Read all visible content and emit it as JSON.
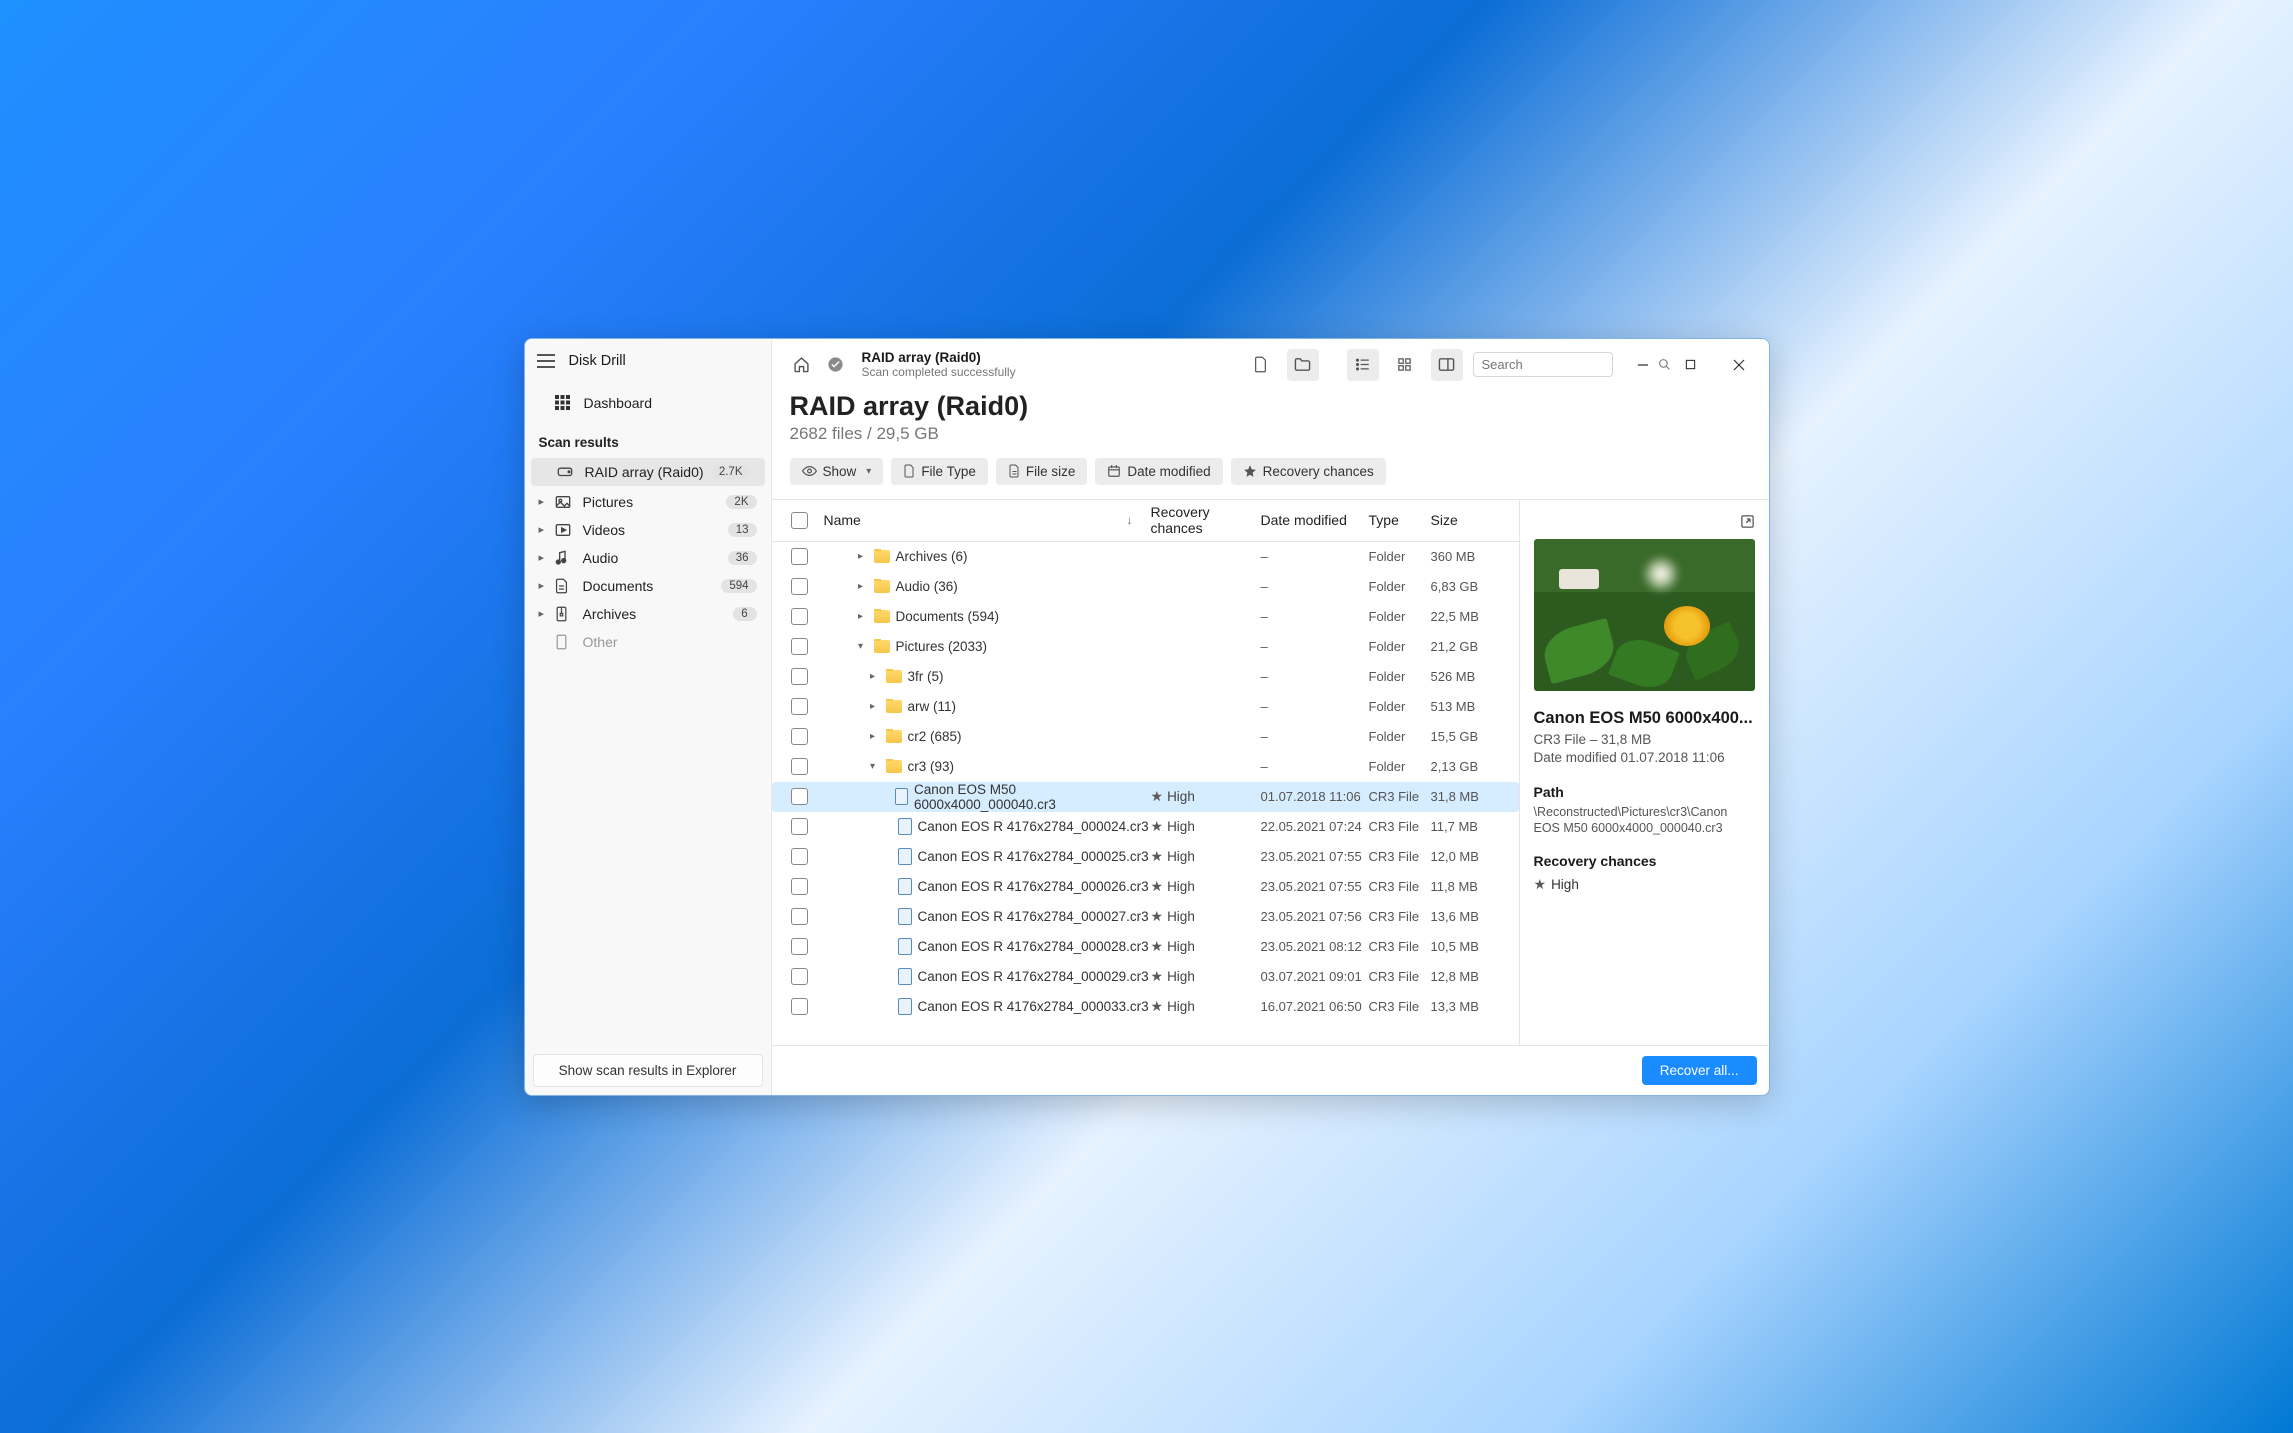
{
  "app_title": "Disk Drill",
  "dashboard_label": "Dashboard",
  "scan_results_label": "Scan results",
  "sidebar_items": [
    {
      "label": "RAID array (Raid0)",
      "count": "2.7K",
      "root": true,
      "icon": "drive"
    },
    {
      "label": "Pictures",
      "count": "2K",
      "icon": "image"
    },
    {
      "label": "Videos",
      "count": "13",
      "icon": "video"
    },
    {
      "label": "Audio",
      "count": "36",
      "icon": "audio"
    },
    {
      "label": "Documents",
      "count": "594",
      "icon": "doc"
    },
    {
      "label": "Archives",
      "count": "6",
      "icon": "archive"
    },
    {
      "label": "Other",
      "count": "",
      "icon": "other",
      "no_chevron": true
    }
  ],
  "explore_button": "Show scan results in Explorer",
  "crumb_title": "RAID array (Raid0)",
  "crumb_sub": "Scan completed successfully",
  "search_placeholder": "Search",
  "page_title": "RAID array (Raid0)",
  "page_sub": "2682 files / 29,5 GB",
  "filters": {
    "show": "Show",
    "file_type": "File Type",
    "file_size": "File size",
    "date_modified": "Date modified",
    "recovery_chances": "Recovery chances"
  },
  "columns": {
    "name": "Name",
    "recovery": "Recovery chances",
    "date": "Date modified",
    "type": "Type",
    "size": "Size"
  },
  "rows": [
    {
      "indent": 0,
      "chev": "r",
      "kind": "folder",
      "name": "Archives (6)",
      "rec": "",
      "date": "–",
      "type": "Folder",
      "size": "360 MB"
    },
    {
      "indent": 0,
      "chev": "r",
      "kind": "folder",
      "name": "Audio (36)",
      "rec": "",
      "date": "–",
      "type": "Folder",
      "size": "6,83 GB"
    },
    {
      "indent": 0,
      "chev": "r",
      "kind": "folder",
      "name": "Documents (594)",
      "rec": "",
      "date": "–",
      "type": "Folder",
      "size": "22,5 MB"
    },
    {
      "indent": 0,
      "chev": "d",
      "kind": "folder",
      "name": "Pictures (2033)",
      "rec": "",
      "date": "–",
      "type": "Folder",
      "size": "21,2 GB"
    },
    {
      "indent": 1,
      "chev": "r",
      "kind": "folder",
      "name": "3fr (5)",
      "rec": "",
      "date": "–",
      "type": "Folder",
      "size": "526 MB"
    },
    {
      "indent": 1,
      "chev": "r",
      "kind": "folder",
      "name": "arw (11)",
      "rec": "",
      "date": "–",
      "type": "Folder",
      "size": "513 MB"
    },
    {
      "indent": 1,
      "chev": "r",
      "kind": "folder",
      "name": "cr2 (685)",
      "rec": "",
      "date": "–",
      "type": "Folder",
      "size": "15,5 GB"
    },
    {
      "indent": 1,
      "chev": "d",
      "kind": "folder",
      "name": "cr3 (93)",
      "rec": "",
      "date": "–",
      "type": "Folder",
      "size": "2,13 GB"
    },
    {
      "indent": 2,
      "chev": "",
      "kind": "file",
      "name": "Canon EOS M50 6000x4000_000040.cr3",
      "rec": "High",
      "date": "01.07.2018 11:06",
      "type": "CR3 File",
      "size": "31,8 MB",
      "selected": true
    },
    {
      "indent": 2,
      "chev": "",
      "kind": "file",
      "name": "Canon EOS R 4176x2784_000024.cr3",
      "rec": "High",
      "date": "22.05.2021 07:24",
      "type": "CR3 File",
      "size": "11,7 MB"
    },
    {
      "indent": 2,
      "chev": "",
      "kind": "file",
      "name": "Canon EOS R 4176x2784_000025.cr3",
      "rec": "High",
      "date": "23.05.2021 07:55",
      "type": "CR3 File",
      "size": "12,0 MB"
    },
    {
      "indent": 2,
      "chev": "",
      "kind": "file",
      "name": "Canon EOS R 4176x2784_000026.cr3",
      "rec": "High",
      "date": "23.05.2021 07:55",
      "type": "CR3 File",
      "size": "11,8 MB"
    },
    {
      "indent": 2,
      "chev": "",
      "kind": "file",
      "name": "Canon EOS R 4176x2784_000027.cr3",
      "rec": "High",
      "date": "23.05.2021 07:56",
      "type": "CR3 File",
      "size": "13,6 MB"
    },
    {
      "indent": 2,
      "chev": "",
      "kind": "file",
      "name": "Canon EOS R 4176x2784_000028.cr3",
      "rec": "High",
      "date": "23.05.2021 08:12",
      "type": "CR3 File",
      "size": "10,5 MB"
    },
    {
      "indent": 2,
      "chev": "",
      "kind": "file",
      "name": "Canon EOS R 4176x2784_000029.cr3",
      "rec": "High",
      "date": "03.07.2021 09:01",
      "type": "CR3 File",
      "size": "12,8 MB"
    },
    {
      "indent": 2,
      "chev": "",
      "kind": "file",
      "name": "Canon EOS R 4176x2784_000033.cr3",
      "rec": "High",
      "date": "16.07.2021 06:50",
      "type": "CR3 File",
      "size": "13,3 MB"
    }
  ],
  "details": {
    "title": "Canon EOS M50 6000x400...",
    "meta": "CR3 File – 31,8 MB",
    "date_label": "Date modified 01.07.2018 11:06",
    "path_heading": "Path",
    "path": "\\Reconstructed\\Pictures\\cr3\\Canon EOS M50 6000x4000_000040.cr3",
    "rec_heading": "Recovery chances",
    "rec_value": "High"
  },
  "recover_button": "Recover all..."
}
